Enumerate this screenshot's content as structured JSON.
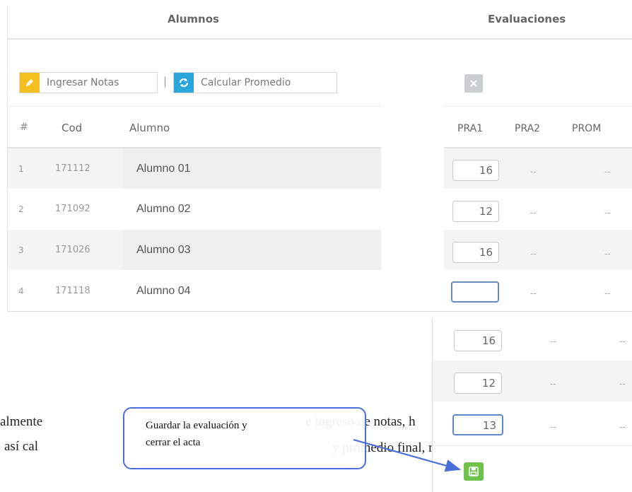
{
  "header": {
    "alumnos": "Alumnos",
    "evaluaciones": "Evaluaciones"
  },
  "toolbar": {
    "ingresar_label": "Ingresar Notas",
    "separator": "|",
    "calcular_label": "Calcular Promedio",
    "pencil_icon": "pencil-icon",
    "refresh_icon": "refresh-icon",
    "close_icon": "close-icon"
  },
  "table": {
    "headers": {
      "num": "#",
      "cod": "Cod",
      "alumno": "Alumno",
      "pra1": "PRA1",
      "pra2": "PRA2",
      "prom": "PROM"
    },
    "rows": [
      {
        "num": "1",
        "cod": "171112",
        "name": "Alumno 01",
        "pra1": "16",
        "pra2": "--",
        "prom": "--"
      },
      {
        "num": "2",
        "cod": "171092",
        "name": "Alumno 02",
        "pra1": "12",
        "pra2": "--",
        "prom": "--"
      },
      {
        "num": "3",
        "cod": "171026",
        "name": "Alumno 03",
        "pra1": "16",
        "pra2": "--",
        "prom": "--"
      },
      {
        "num": "4",
        "cod": "171118",
        "name": "Alumno 04",
        "pra1": "",
        "pra2": "--",
        "prom": "--"
      }
    ]
  },
  "overlay": {
    "rows": [
      {
        "pra1": "16",
        "pra2": "--",
        "prom": "--"
      },
      {
        "pra1": "12",
        "pra2": "--",
        "prom": "--"
      },
      {
        "pra1": "13",
        "pra2": "--",
        "prom": "--"
      }
    ],
    "save_icon": "floppy-save-icon"
  },
  "background_doc": {
    "line1_left": "almente",
    "line1_mid": "e ingreso de notas, h",
    "line2_left": "así cal",
    "line2_mid": "y promedio final, r"
  },
  "callout": {
    "line1": "Guardar la evaluación y",
    "line2": "cerrar el acta"
  },
  "colors": {
    "callout_border": "#4a6fd8",
    "save_button": "#6cc24a",
    "pencil_button": "#f3c11f",
    "refresh_button": "#2aa6dc"
  }
}
